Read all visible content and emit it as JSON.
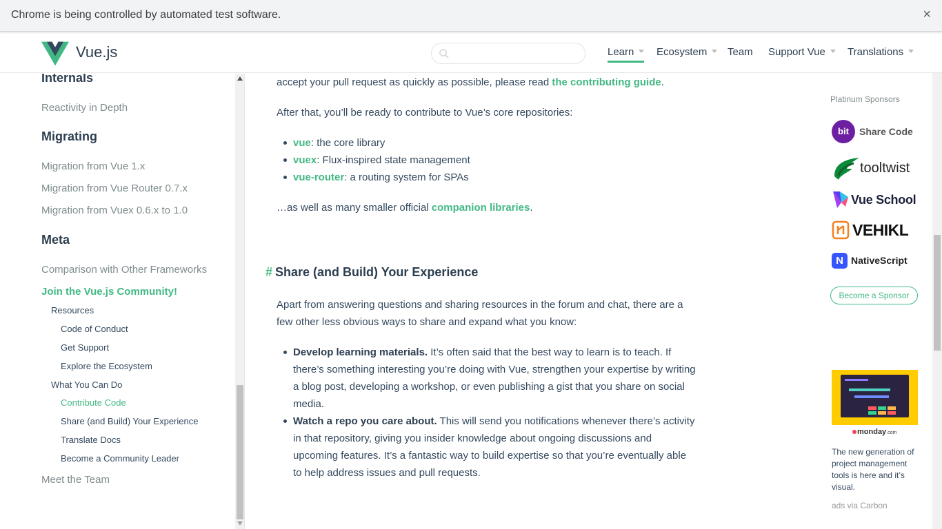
{
  "infobar": {
    "message": "Chrome is being controlled by automated test software.",
    "close_glyph": "×"
  },
  "header": {
    "logo_text": "Vue.js",
    "search": {
      "value": "",
      "placeholder": ""
    },
    "nav": [
      {
        "label": "Learn",
        "dropdown": true,
        "active": true
      },
      {
        "label": "Ecosystem",
        "dropdown": true
      },
      {
        "label": "Team",
        "dropdown": false
      },
      {
        "label": "Support Vue",
        "dropdown": true
      },
      {
        "label": "Translations",
        "dropdown": true
      }
    ]
  },
  "sidebar": {
    "internals_heading": "Internals",
    "reactivity": "Reactivity in Depth",
    "migrating_heading": "Migrating",
    "migration_vue": "Migration from Vue 1.x",
    "migration_router": "Migration from Vue Router 0.7.x",
    "migration_vuex": "Migration from Vuex 0.6.x to 1.0",
    "meta_heading": "Meta",
    "comparison": "Comparison with Other Frameworks",
    "join": "Join the Vue.js Community!",
    "resources": "Resources",
    "code_of_conduct": "Code of Conduct",
    "get_support": "Get Support",
    "explore": "Explore the Ecosystem",
    "what_you_can_do": "What You Can Do",
    "contribute": "Contribute Code",
    "share": "Share (and Build) Your Experience",
    "translate": "Translate Docs",
    "leader": "Become a Community Leader",
    "meet_team": "Meet the Team"
  },
  "content": {
    "p1_text": "accept your pull request as quickly as possible, please read ",
    "p1_link": "the contributing guide",
    "p1_end": ".",
    "p2": "After that, you’ll be ready to contribute to Vue’s core repositories:",
    "repos": [
      {
        "name": "vue",
        "desc": ": the core library"
      },
      {
        "name": "vuex",
        "desc": ": Flux-inspired state management"
      },
      {
        "name": "vue-router",
        "desc": ": a routing system for SPAs"
      }
    ],
    "p3_text": "…as well as many smaller official ",
    "p3_link": "companion libraries",
    "p3_end": ".",
    "h2_hash": "#",
    "h2": "Share (and Build) Your Experience",
    "p4": "Apart from answering questions and sharing resources in the forum and chat, there are a few other less obvious ways to share and expand what you know:",
    "bullets": [
      {
        "bold": "Develop learning materials.",
        "text": " It’s often said that the best way to learn is to teach. If there’s something interesting you’re doing with Vue, strengthen your expertise by writing a blog post, developing a workshop, or even publishing a gist that you share on social media."
      },
      {
        "bold": "Watch a repo you care about.",
        "text": " This will send you notifications whenever there’s activity in that repository, giving you insider knowledge about ongoing discussions and upcoming features. It’s a fantastic way to build expertise so that you’re eventually able to help address issues and pull requests."
      }
    ]
  },
  "sponsors": {
    "title": "Platinum Sponsors",
    "items": [
      {
        "name": "Share Code",
        "badge": "bit"
      },
      {
        "name": "tooltwist"
      },
      {
        "name": "Vue School"
      },
      {
        "name": "VEHIKL"
      },
      {
        "name": "NativeScript",
        "badge": "N"
      }
    ],
    "become": "Become a Sponsor"
  },
  "ad": {
    "logo": "monday",
    "logo_suffix": ".com",
    "text": "The new generation of project management tools is here and it’s visual.",
    "via": "ads via Carbon"
  },
  "colors": {
    "accent": "#42b983",
    "text": "#34495e",
    "heading": "#2c3e50"
  }
}
